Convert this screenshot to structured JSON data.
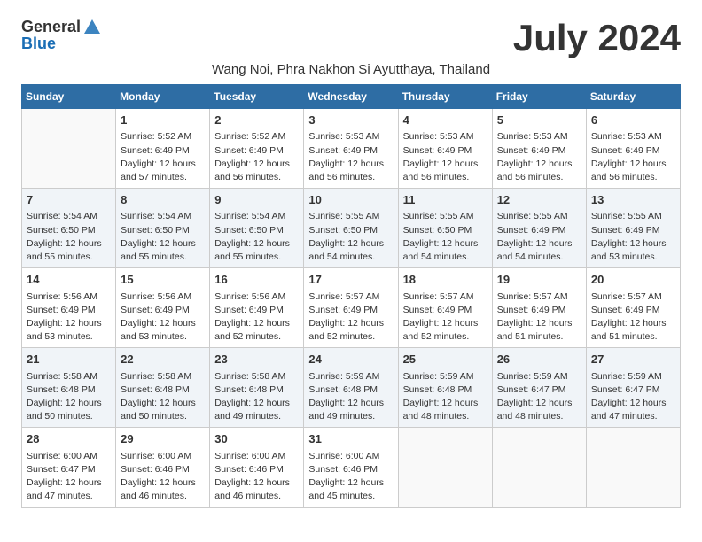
{
  "logo": {
    "general": "General",
    "blue": "Blue"
  },
  "title": "July 2024",
  "location": "Wang Noi, Phra Nakhon Si Ayutthaya, Thailand",
  "weekdays": [
    "Sunday",
    "Monday",
    "Tuesday",
    "Wednesday",
    "Thursday",
    "Friday",
    "Saturday"
  ],
  "weeks": [
    [
      {
        "day": "",
        "info": ""
      },
      {
        "day": "1",
        "info": "Sunrise: 5:52 AM\nSunset: 6:49 PM\nDaylight: 12 hours\nand 57 minutes."
      },
      {
        "day": "2",
        "info": "Sunrise: 5:52 AM\nSunset: 6:49 PM\nDaylight: 12 hours\nand 56 minutes."
      },
      {
        "day": "3",
        "info": "Sunrise: 5:53 AM\nSunset: 6:49 PM\nDaylight: 12 hours\nand 56 minutes."
      },
      {
        "day": "4",
        "info": "Sunrise: 5:53 AM\nSunset: 6:49 PM\nDaylight: 12 hours\nand 56 minutes."
      },
      {
        "day": "5",
        "info": "Sunrise: 5:53 AM\nSunset: 6:49 PM\nDaylight: 12 hours\nand 56 minutes."
      },
      {
        "day": "6",
        "info": "Sunrise: 5:53 AM\nSunset: 6:49 PM\nDaylight: 12 hours\nand 56 minutes."
      }
    ],
    [
      {
        "day": "7",
        "info": "Sunrise: 5:54 AM\nSunset: 6:50 PM\nDaylight: 12 hours\nand 55 minutes."
      },
      {
        "day": "8",
        "info": "Sunrise: 5:54 AM\nSunset: 6:50 PM\nDaylight: 12 hours\nand 55 minutes."
      },
      {
        "day": "9",
        "info": "Sunrise: 5:54 AM\nSunset: 6:50 PM\nDaylight: 12 hours\nand 55 minutes."
      },
      {
        "day": "10",
        "info": "Sunrise: 5:55 AM\nSunset: 6:50 PM\nDaylight: 12 hours\nand 54 minutes."
      },
      {
        "day": "11",
        "info": "Sunrise: 5:55 AM\nSunset: 6:50 PM\nDaylight: 12 hours\nand 54 minutes."
      },
      {
        "day": "12",
        "info": "Sunrise: 5:55 AM\nSunset: 6:49 PM\nDaylight: 12 hours\nand 54 minutes."
      },
      {
        "day": "13",
        "info": "Sunrise: 5:55 AM\nSunset: 6:49 PM\nDaylight: 12 hours\nand 53 minutes."
      }
    ],
    [
      {
        "day": "14",
        "info": "Sunrise: 5:56 AM\nSunset: 6:49 PM\nDaylight: 12 hours\nand 53 minutes."
      },
      {
        "day": "15",
        "info": "Sunrise: 5:56 AM\nSunset: 6:49 PM\nDaylight: 12 hours\nand 53 minutes."
      },
      {
        "day": "16",
        "info": "Sunrise: 5:56 AM\nSunset: 6:49 PM\nDaylight: 12 hours\nand 52 minutes."
      },
      {
        "day": "17",
        "info": "Sunrise: 5:57 AM\nSunset: 6:49 PM\nDaylight: 12 hours\nand 52 minutes."
      },
      {
        "day": "18",
        "info": "Sunrise: 5:57 AM\nSunset: 6:49 PM\nDaylight: 12 hours\nand 52 minutes."
      },
      {
        "day": "19",
        "info": "Sunrise: 5:57 AM\nSunset: 6:49 PM\nDaylight: 12 hours\nand 51 minutes."
      },
      {
        "day": "20",
        "info": "Sunrise: 5:57 AM\nSunset: 6:49 PM\nDaylight: 12 hours\nand 51 minutes."
      }
    ],
    [
      {
        "day": "21",
        "info": "Sunrise: 5:58 AM\nSunset: 6:48 PM\nDaylight: 12 hours\nand 50 minutes."
      },
      {
        "day": "22",
        "info": "Sunrise: 5:58 AM\nSunset: 6:48 PM\nDaylight: 12 hours\nand 50 minutes."
      },
      {
        "day": "23",
        "info": "Sunrise: 5:58 AM\nSunset: 6:48 PM\nDaylight: 12 hours\nand 49 minutes."
      },
      {
        "day": "24",
        "info": "Sunrise: 5:59 AM\nSunset: 6:48 PM\nDaylight: 12 hours\nand 49 minutes."
      },
      {
        "day": "25",
        "info": "Sunrise: 5:59 AM\nSunset: 6:48 PM\nDaylight: 12 hours\nand 48 minutes."
      },
      {
        "day": "26",
        "info": "Sunrise: 5:59 AM\nSunset: 6:47 PM\nDaylight: 12 hours\nand 48 minutes."
      },
      {
        "day": "27",
        "info": "Sunrise: 5:59 AM\nSunset: 6:47 PM\nDaylight: 12 hours\nand 47 minutes."
      }
    ],
    [
      {
        "day": "28",
        "info": "Sunrise: 6:00 AM\nSunset: 6:47 PM\nDaylight: 12 hours\nand 47 minutes."
      },
      {
        "day": "29",
        "info": "Sunrise: 6:00 AM\nSunset: 6:46 PM\nDaylight: 12 hours\nand 46 minutes."
      },
      {
        "day": "30",
        "info": "Sunrise: 6:00 AM\nSunset: 6:46 PM\nDaylight: 12 hours\nand 46 minutes."
      },
      {
        "day": "31",
        "info": "Sunrise: 6:00 AM\nSunset: 6:46 PM\nDaylight: 12 hours\nand 45 minutes."
      },
      {
        "day": "",
        "info": ""
      },
      {
        "day": "",
        "info": ""
      },
      {
        "day": "",
        "info": ""
      }
    ]
  ],
  "rowShading": [
    false,
    true,
    false,
    true,
    false
  ]
}
